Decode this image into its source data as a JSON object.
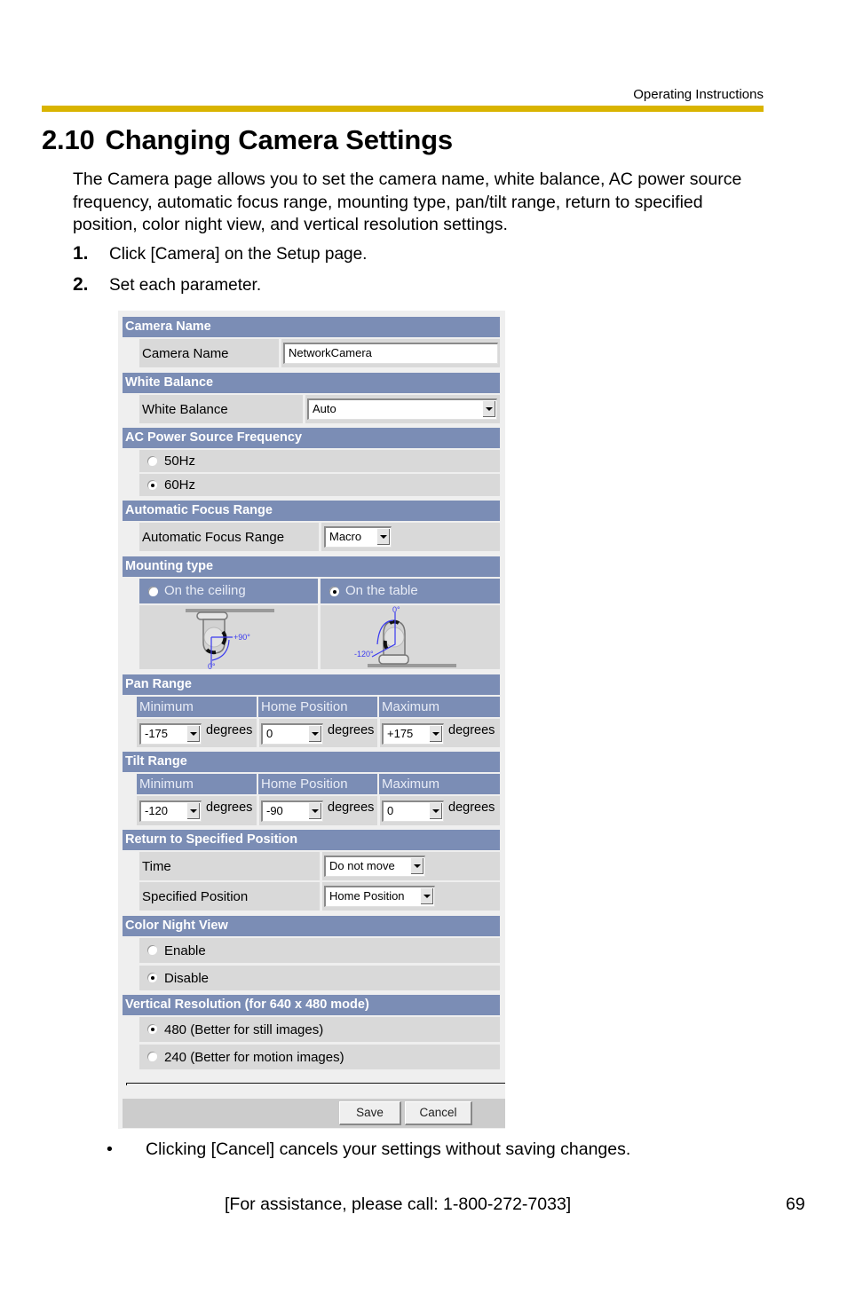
{
  "header": {
    "running_head": "Operating Instructions",
    "rule_color": "#d9b400"
  },
  "section": {
    "number": "2.10",
    "title": "Changing Camera Settings",
    "intro": "The Camera page allows you to set the camera name, white balance, AC power source frequency, automatic focus range, mounting type, pan/tilt range, return to specified position, color night view, and vertical resolution settings.",
    "steps": [
      {
        "num": "1.",
        "text": "Click [Camera] on the Setup page."
      },
      {
        "num": "2.",
        "text": "Set each parameter."
      }
    ]
  },
  "form": {
    "header_color": "#7b8db5",
    "camera_name": {
      "heading": "Camera Name",
      "label": "Camera Name",
      "value": "NetworkCamera"
    },
    "white_balance": {
      "heading": "White Balance",
      "label": "White Balance",
      "value": "Auto"
    },
    "ac_power": {
      "heading": "AC Power Source Frequency",
      "options": [
        {
          "label": "50Hz",
          "checked": false
        },
        {
          "label": "60Hz",
          "checked": true
        }
      ]
    },
    "focus": {
      "heading": "Automatic Focus Range",
      "label": "Automatic Focus Range",
      "value": "Macro"
    },
    "mounting": {
      "heading": "Mounting type",
      "options": [
        {
          "label": "On the ceiling",
          "checked": false,
          "angle_top": "+90°",
          "angle_bottom": "0°"
        },
        {
          "label": "On the table",
          "checked": true,
          "angle_top": "0°",
          "angle_bottom": "-120°"
        }
      ]
    },
    "pan": {
      "heading": "Pan Range",
      "columns": [
        "Minimum",
        "Home Position",
        "Maximum"
      ],
      "values": [
        "-175",
        "0",
        "+175"
      ],
      "unit": "degrees"
    },
    "tilt": {
      "heading": "Tilt Range",
      "columns": [
        "Minimum",
        "Home Position",
        "Maximum"
      ],
      "values": [
        "-120",
        "-90",
        "0"
      ],
      "unit": "degrees"
    },
    "return_position": {
      "heading": "Return to Specified Position",
      "time_label": "Time",
      "time_value": "Do not move",
      "position_label": "Specified Position",
      "position_value": "Home Position"
    },
    "night_view": {
      "heading": "Color Night View",
      "options": [
        {
          "label": "Enable",
          "checked": false
        },
        {
          "label": "Disable",
          "checked": true
        }
      ]
    },
    "resolution": {
      "heading": "Vertical Resolution (for 640 x 480 mode)",
      "options": [
        {
          "label": "480 (Better for still images)",
          "checked": true
        },
        {
          "label": "240 (Better for motion images)",
          "checked": false
        }
      ]
    },
    "buttons": {
      "save": "Save",
      "cancel": "Cancel"
    }
  },
  "note": {
    "bullet": "•",
    "text": "Clicking [Cancel] cancels your settings without saving changes."
  },
  "footer": {
    "assistance": "[For assistance, please call: 1-800-272-7033]",
    "page_number": "69"
  }
}
